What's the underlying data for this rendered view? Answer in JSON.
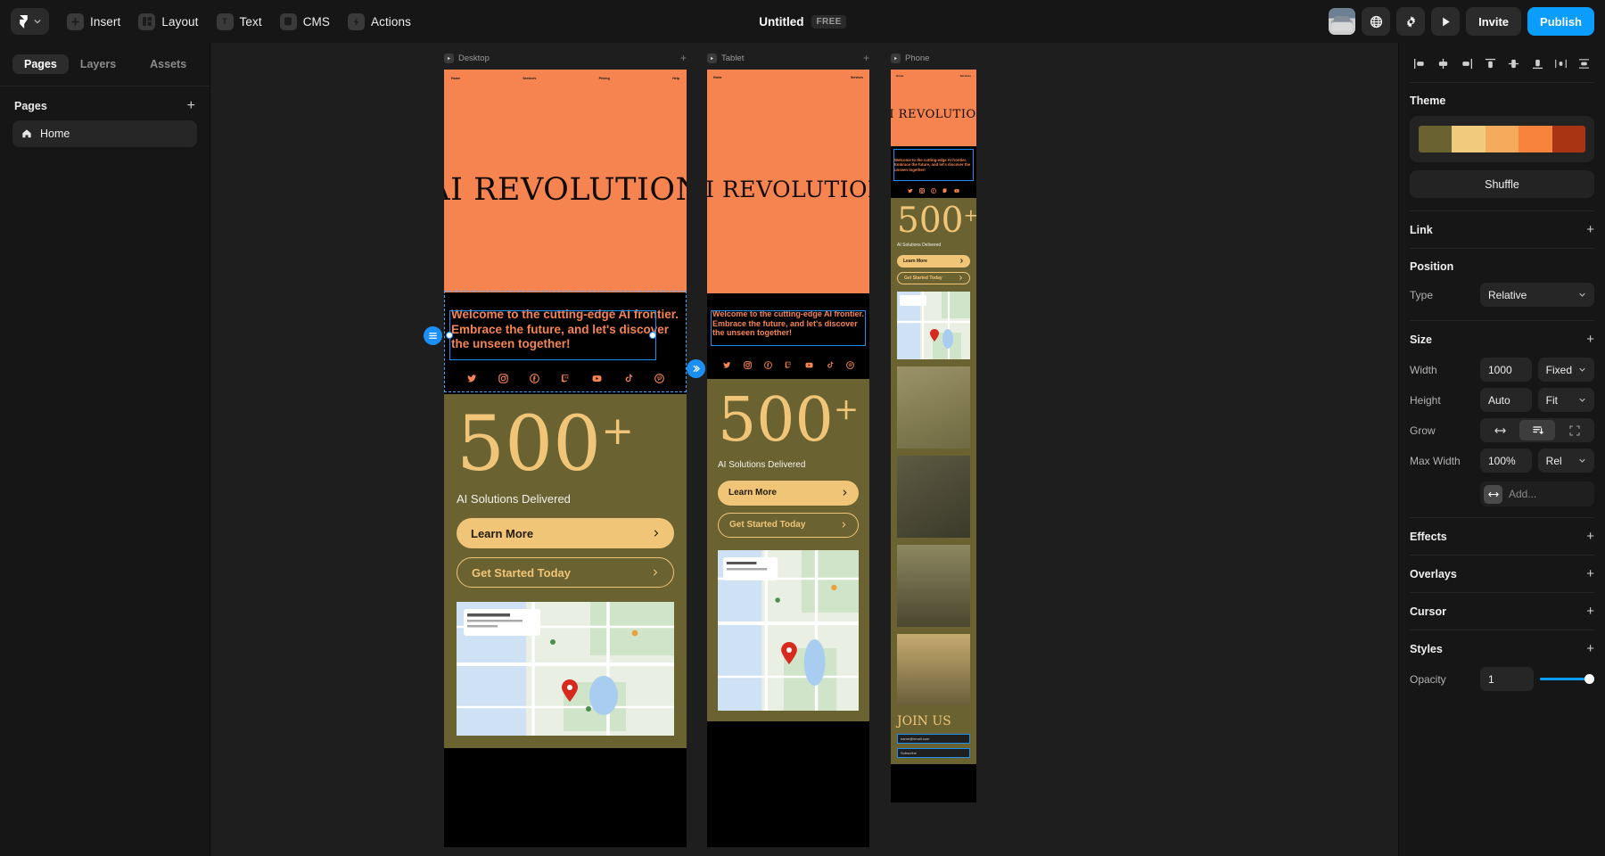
{
  "topbar": {
    "logo_icon": "framer-logo-icon",
    "menu_items": [
      {
        "label": "Insert",
        "icon": "plus-square-icon"
      },
      {
        "label": "Layout",
        "icon": "layout-panels-icon"
      },
      {
        "label": "Text",
        "icon": "text-t-icon"
      },
      {
        "label": "CMS",
        "icon": "database-icon"
      },
      {
        "label": "Actions",
        "icon": "lightning-bolt-icon"
      }
    ],
    "doc_title": "Untitled",
    "plan_badge": "FREE",
    "avatar_name": "user-avatar",
    "right_icons": [
      {
        "name": "globe-icon"
      },
      {
        "name": "gear-icon"
      },
      {
        "name": "play-icon"
      }
    ],
    "invite_label": "Invite",
    "publish_label": "Publish",
    "publish_color": "#0b9dfb"
  },
  "left_panel": {
    "tabs": [
      {
        "label": "Pages",
        "active": true
      },
      {
        "label": "Layers",
        "active": false
      },
      {
        "label": "Assets",
        "active": false
      }
    ],
    "section_title": "Pages",
    "add_label": "+",
    "pages": [
      {
        "label": "Home",
        "icon": "home-icon",
        "selected": true
      }
    ]
  },
  "canvas": {
    "background": "#1e1e1e",
    "frames": [
      {
        "name": "Desktop",
        "label": "Desktop"
      },
      {
        "name": "Tablet",
        "label": "Tablet"
      },
      {
        "name": "Phone",
        "label": "Phone"
      }
    ],
    "site": {
      "nav_items": [
        "Home",
        "Services",
        "Pricing",
        "Help"
      ],
      "nav_items_tablet": [
        "Home",
        "Services"
      ],
      "nav_items_phone": [
        "Home",
        "Services"
      ],
      "hero_title": "AI REVOLUTION",
      "tagline": "Welcome to the cutting-edge AI frontier. Embrace the future, and let's discover the unseen together!",
      "social_icons": [
        "twitter-icon",
        "instagram-icon",
        "facebook-icon",
        "twitch-icon",
        "youtube-icon",
        "tiktok-icon",
        "pinterest-icon"
      ],
      "stat_number": "500",
      "stat_plus": "+",
      "stat_caption": "AI Solutions Delivered",
      "cta_primary": "Learn More",
      "cta_secondary": "Get Started Today",
      "join_title": "JOIN US",
      "email_placeholder": "name@email.com",
      "subscribe_label": "Subscribe",
      "colors": {
        "orange": "#f58451",
        "olive": "#6b6231",
        "sand": "#f0c578",
        "black": "#000000"
      }
    },
    "selection": {
      "type": "text-element",
      "handle_color": "#1c8ff5",
      "stack_badge_icon": "stack-list-icon"
    }
  },
  "right_panel": {
    "align_icons": [
      "align-left-icon",
      "align-center-horizontal-icon",
      "align-right-icon",
      "align-top-icon",
      "align-center-vertical-icon",
      "align-bottom-icon",
      "distribute-horizontal-icon",
      "distribute-vertical-icon"
    ],
    "theme": {
      "title": "Theme",
      "swatches": [
        "#6b6231",
        "#f0ca7d",
        "#f5ab5c",
        "#f8833d",
        "#a83413"
      ],
      "shuffle_label": "Shuffle"
    },
    "link": {
      "title": "Link",
      "add": "+"
    },
    "position": {
      "title": "Position",
      "type_label": "Type",
      "type_value": "Relative"
    },
    "size": {
      "title": "Size",
      "add": "+",
      "width_label": "Width",
      "width_value": "1000",
      "width_mode": "Fixed",
      "height_label": "Height",
      "height_value": "Auto",
      "height_mode": "Fit",
      "grow_label": "Grow",
      "grow_options": [
        "grow-horizontal-icon",
        "grow-vertical-icon",
        "grow-both-icon"
      ],
      "grow_selected_index": 1,
      "maxwidth_label": "Max Width",
      "maxwidth_value": "100%",
      "maxwidth_mode": "Rel",
      "add_icon": "arrows-horizontal-icon",
      "add_placeholder": "Add..."
    },
    "effects": {
      "title": "Effects",
      "add": "+"
    },
    "overlays": {
      "title": "Overlays",
      "add": "+"
    },
    "cursor": {
      "title": "Cursor",
      "add": "+"
    },
    "styles": {
      "title": "Styles",
      "add": "+",
      "opacity_label": "Opacity",
      "opacity_value": "1",
      "slider_color": "#0b9dfb"
    }
  }
}
